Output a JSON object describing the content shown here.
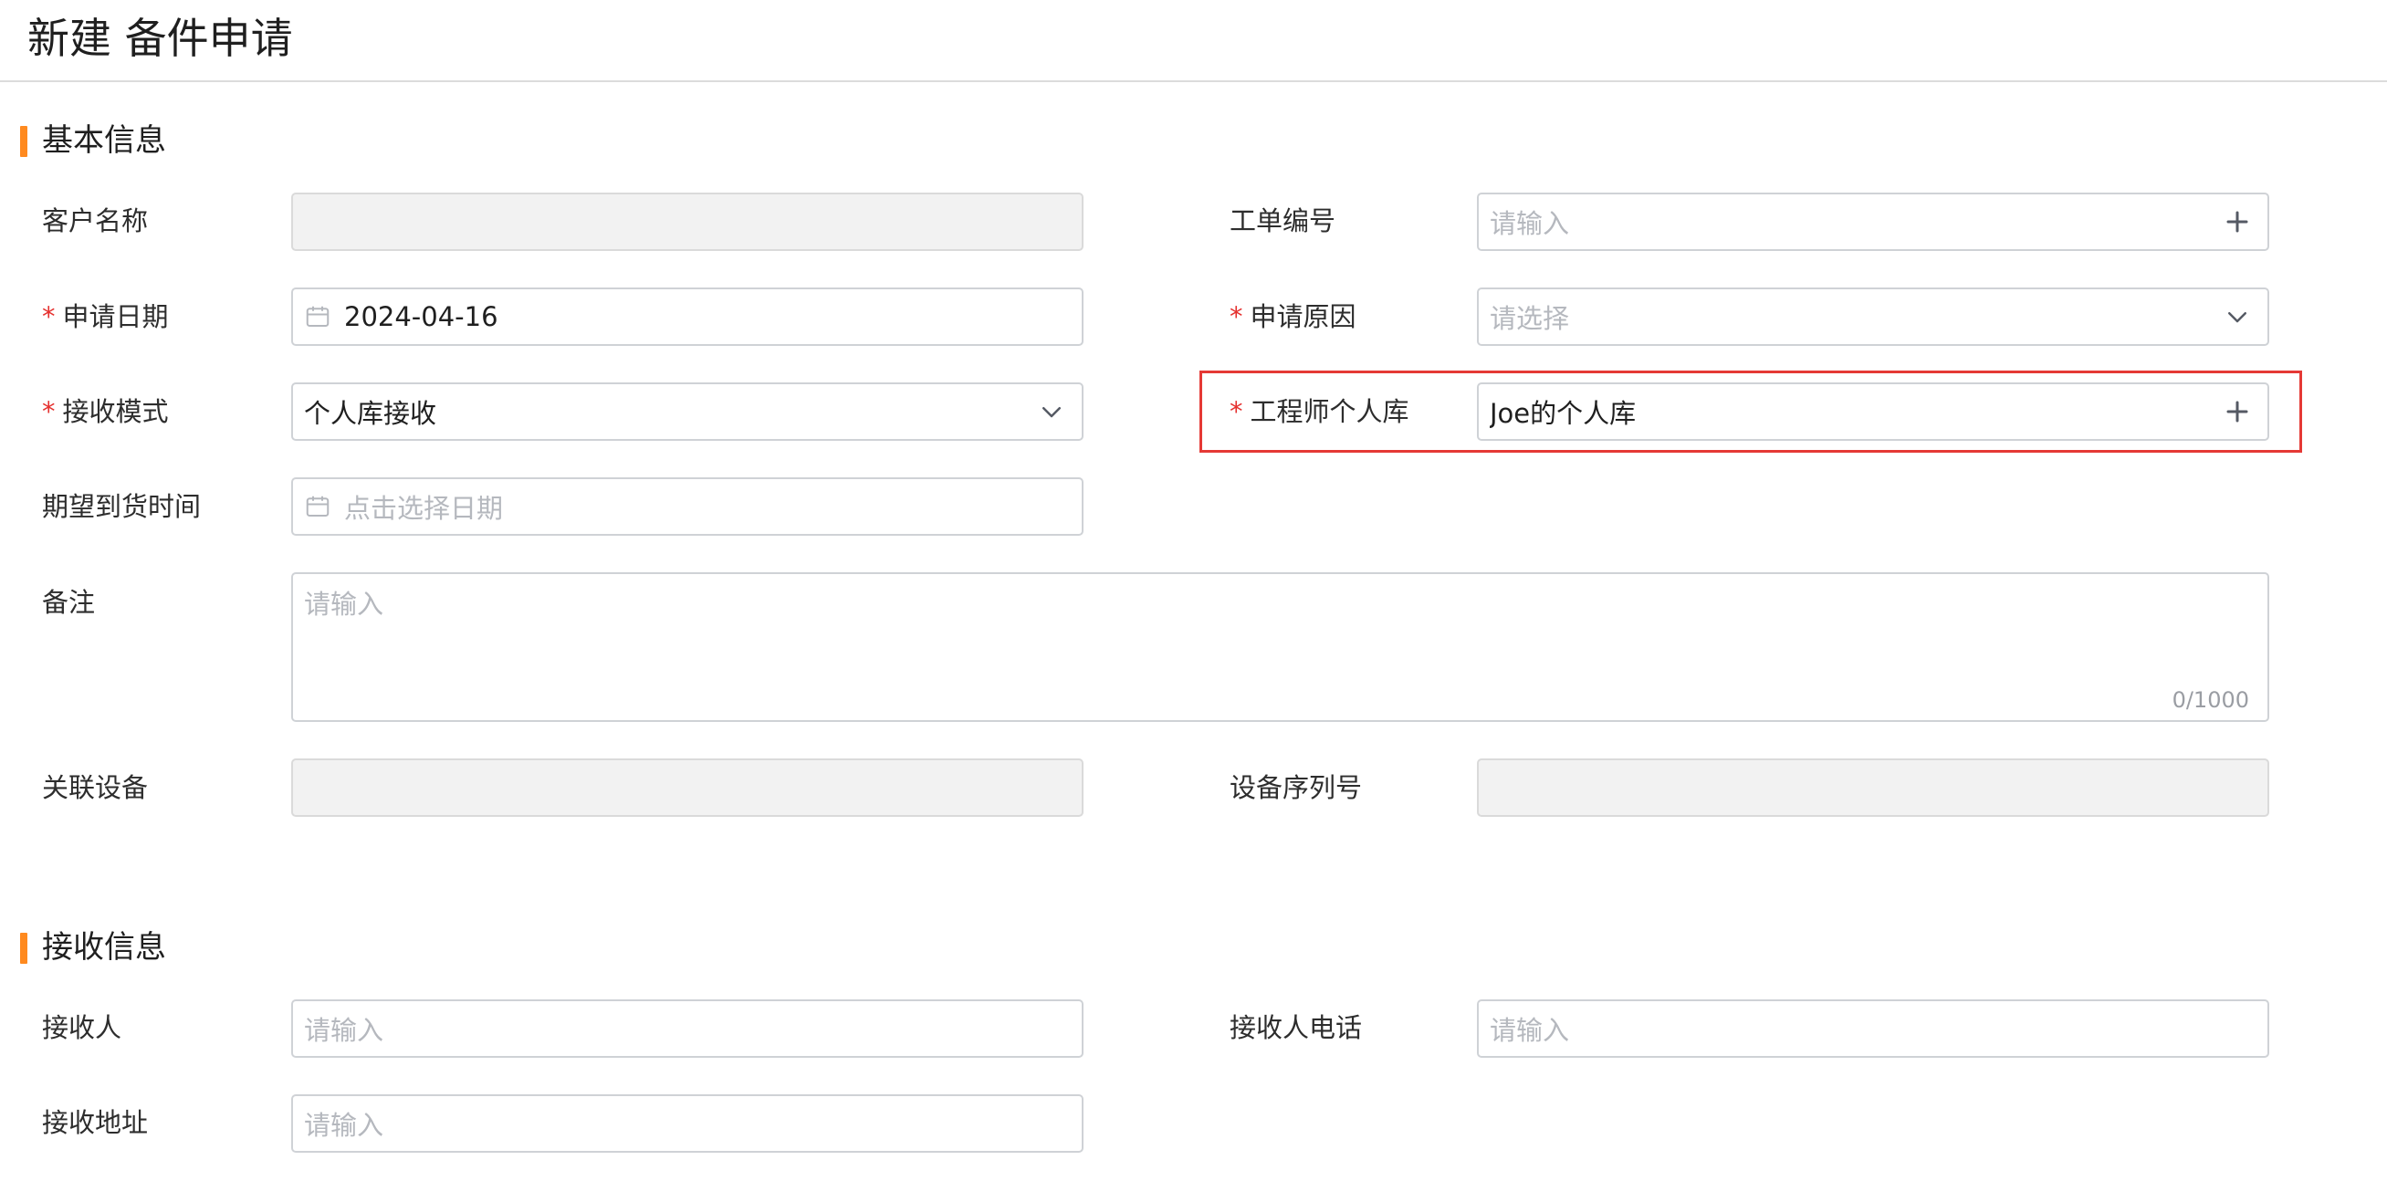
{
  "page": {
    "title": "新建 备件申请"
  },
  "sections": {
    "basic": {
      "title": "基本信息"
    },
    "receive": {
      "title": "接收信息"
    }
  },
  "fields": {
    "customer_name": {
      "label": "客户名称",
      "value": "",
      "disabled": true
    },
    "work_order_no": {
      "label": "工单编号",
      "placeholder": "请输入"
    },
    "apply_date": {
      "label": "申请日期",
      "required_mark": "*",
      "value": "2024-04-16"
    },
    "apply_reason": {
      "label": "申请原因",
      "required_mark": "*",
      "placeholder": "请选择"
    },
    "receive_mode": {
      "label": "接收模式",
      "required_mark": "*",
      "value": "个人库接收"
    },
    "engineer_store": {
      "label": "工程师个人库",
      "required_mark": "*",
      "value": "Joe的个人库"
    },
    "expected_arrival": {
      "label": "期望到货时间",
      "placeholder": "点击选择日期"
    },
    "remark": {
      "label": "备注",
      "placeholder": "请输入",
      "counter": "0/1000"
    },
    "related_device": {
      "label": "关联设备",
      "value": "",
      "disabled": true
    },
    "device_serial": {
      "label": "设备序列号",
      "value": "",
      "disabled": true
    },
    "receiver": {
      "label": "接收人",
      "placeholder": "请输入"
    },
    "receiver_phone": {
      "label": "接收人电话",
      "placeholder": "请输入"
    },
    "receiver_address": {
      "label": "接收地址",
      "placeholder": "请输入"
    }
  },
  "icons": {
    "calendar": "calendar-icon",
    "plus": "plus-icon",
    "chevron": "chevron-down-icon"
  },
  "colors": {
    "accent": "#ff8a1f",
    "required": "#e5312f",
    "highlight": "#e53935",
    "placeholder": "#b5b8be"
  }
}
